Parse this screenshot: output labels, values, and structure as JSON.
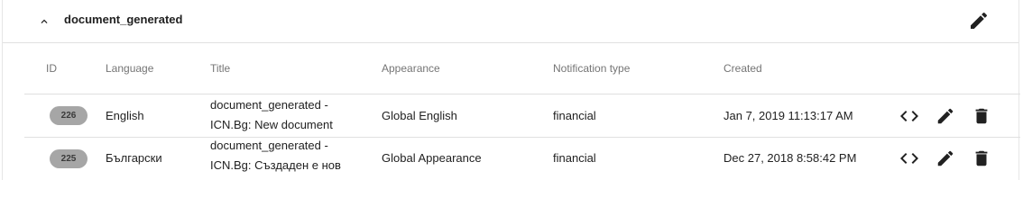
{
  "section": {
    "title": "document_generated"
  },
  "columns": {
    "id": "ID",
    "language": "Language",
    "title": "Title",
    "appearance": "Appearance",
    "notification_type": "Notification type",
    "created": "Created"
  },
  "rows": [
    {
      "id": "226",
      "language": "English",
      "title_line1": "document_generated -",
      "title_line2": "ICN.Bg: New document",
      "appearance": "Global English",
      "notification_type": "financial",
      "created": "Jan 7, 2019 11:13:17 AM"
    },
    {
      "id": "225",
      "language": "Български",
      "title_line1": "document_generated -",
      "title_line2": "ICN.Bg: Създаден е нов",
      "appearance": "Global Appearance",
      "notification_type": "financial",
      "created": "Dec 27, 2018 8:58:42 PM"
    }
  ],
  "icons": {
    "collapse": "chevron-up-icon",
    "edit": "pencil-icon",
    "code": "code-icon",
    "delete": "trash-icon"
  },
  "colors": {
    "chip_bg": "#a6a6a6",
    "icon": "#212121",
    "divider": "#e0e0e0",
    "header_text": "#757575"
  }
}
